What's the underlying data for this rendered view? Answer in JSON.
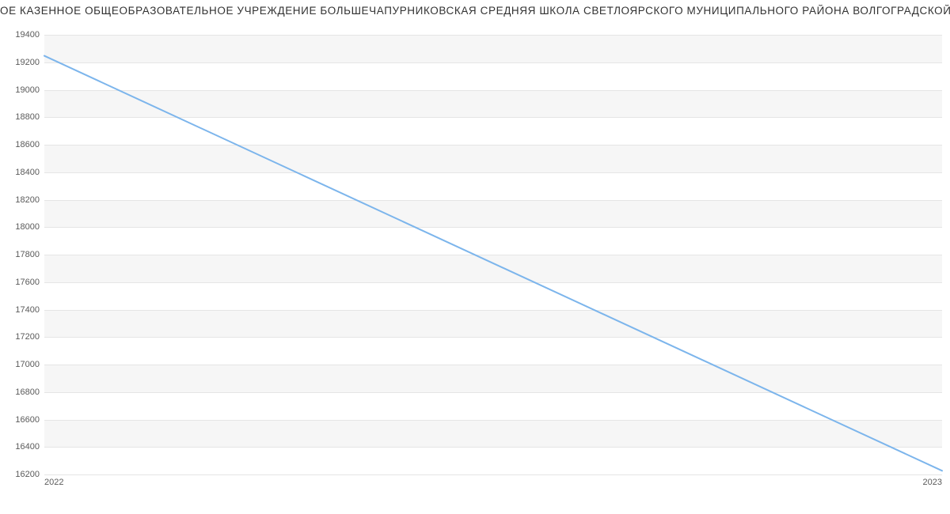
{
  "chart_data": {
    "type": "line",
    "title": "ОЕ КАЗЕННОЕ ОБЩЕОБРАЗОВАТЕЛЬНОЕ УЧРЕЖДЕНИЕ БОЛЬШЕЧАПУРНИКОВСКАЯ СРЕДНЯЯ ШКОЛА СВЕТЛОЯРСКОГО МУНИЦИПАЛЬНОГО РАЙОНА ВОЛГОГРАДСКОЙ ОБЛ",
    "x": [
      2022,
      2023
    ],
    "values": [
      19247,
      16227
    ],
    "xlabel": "",
    "ylabel": "",
    "ylim": [
      16200,
      19400
    ],
    "y_ticks": [
      16200,
      16400,
      16600,
      16800,
      17000,
      17200,
      17400,
      17600,
      17800,
      18000,
      18200,
      18400,
      18600,
      18800,
      19000,
      19200,
      19400
    ],
    "x_ticks": [
      2022,
      2023
    ],
    "line_color": "#7cb5ec"
  }
}
